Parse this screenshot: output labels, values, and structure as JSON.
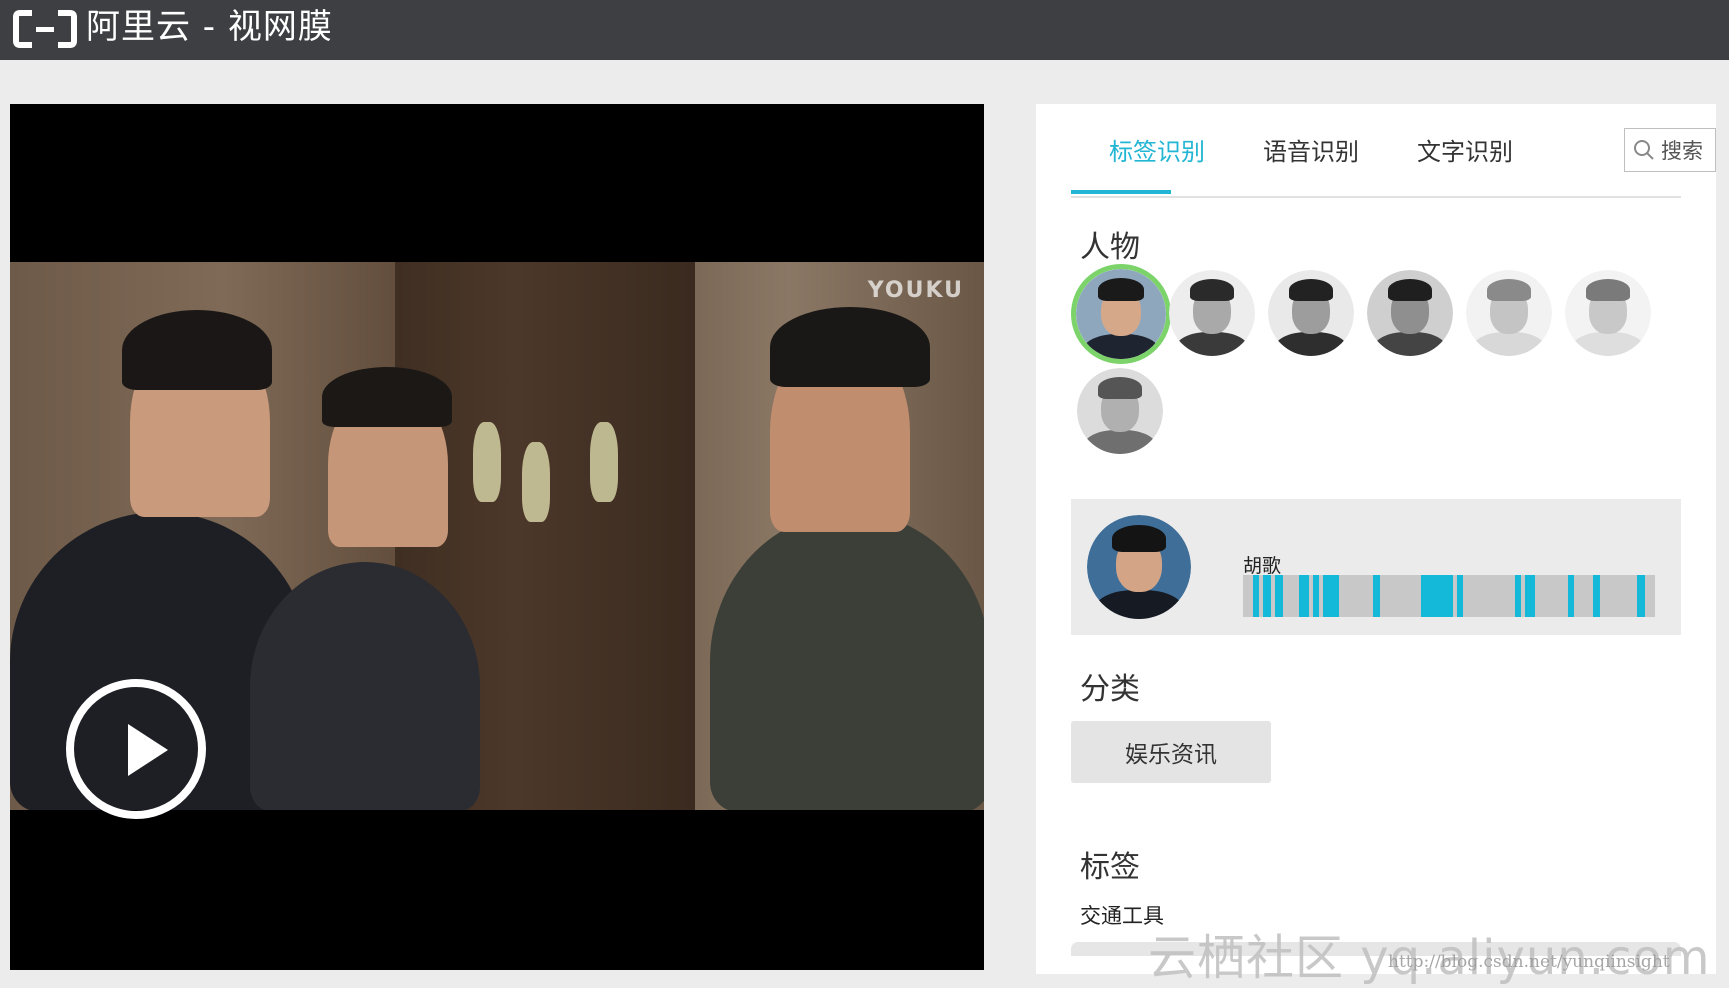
{
  "header": {
    "title": "阿里云 - 视网膜",
    "logo_icon": "aliyun-bracket-logo",
    "background": "#3d3f42"
  },
  "video": {
    "watermark": "YOUKU",
    "play_icon": "play-icon"
  },
  "tabs": [
    {
      "label": "标签识别",
      "active": true
    },
    {
      "label": "语音识别",
      "active": false
    },
    {
      "label": "文字识别",
      "active": false
    }
  ],
  "search": {
    "label": "搜索",
    "icon": "search-icon"
  },
  "people": {
    "title": "人物",
    "selected_index": 0,
    "selected_name": "胡歌",
    "timeline_color": "#14b8d8",
    "selection_color": "#7bd36a"
  },
  "category": {
    "title": "分类",
    "chip": "娱乐资讯"
  },
  "tags": {
    "title": "标签",
    "first_tag": "交通工具"
  },
  "watermark": {
    "text": "云栖社区 yq.aliyun.com",
    "url": "http://blog.csdn.net/yunqiinsight"
  },
  "accent_color": "#22b6d4"
}
